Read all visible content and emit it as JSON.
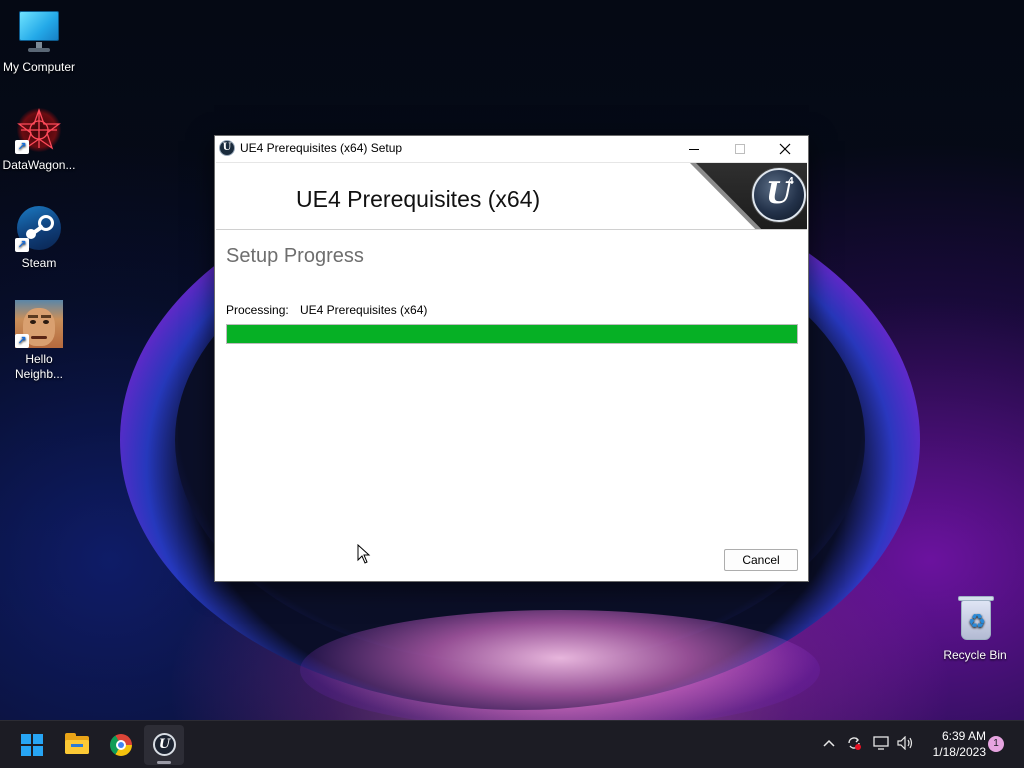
{
  "desktop": {
    "icons": [
      {
        "label": "My Computer",
        "icon": "monitor-icon"
      },
      {
        "label": "DataWagon...",
        "icon": "datawagon-icon"
      },
      {
        "label": "Steam",
        "icon": "steam-icon"
      },
      {
        "label": "Hello\nNeighb...",
        "icon": "hello-neighbor-icon"
      },
      {
        "label": "Recycle Bin",
        "icon": "recycle-bin-icon"
      }
    ]
  },
  "window": {
    "title": "UE4 Prerequisites (x64) Setup",
    "banner_heading": "UE4 Prerequisites (x64)",
    "section_title": "Setup Progress",
    "processing_label": "Processing:",
    "processing_value": "UE4 Prerequisites (x64)",
    "progress_percent": 100,
    "progress_color": "#06b025",
    "cancel_label": "Cancel",
    "logo_glyph": "U",
    "logo_superscript": "4"
  },
  "taskbar": {
    "items": [
      {
        "name": "start",
        "icon": "windows-logo-icon"
      },
      {
        "name": "file-explorer",
        "icon": "folder-icon"
      },
      {
        "name": "chrome",
        "icon": "chrome-icon"
      },
      {
        "name": "ue4-setup",
        "icon": "unreal-engine-icon",
        "active": true
      }
    ],
    "tray": {
      "icons": [
        "chevron-up-icon",
        "sync-icon",
        "network-icon",
        "volume-icon"
      ],
      "time": "6:39 AM",
      "date": "1/18/2023",
      "notifications": "1"
    },
    "ue_glyph": "U"
  }
}
